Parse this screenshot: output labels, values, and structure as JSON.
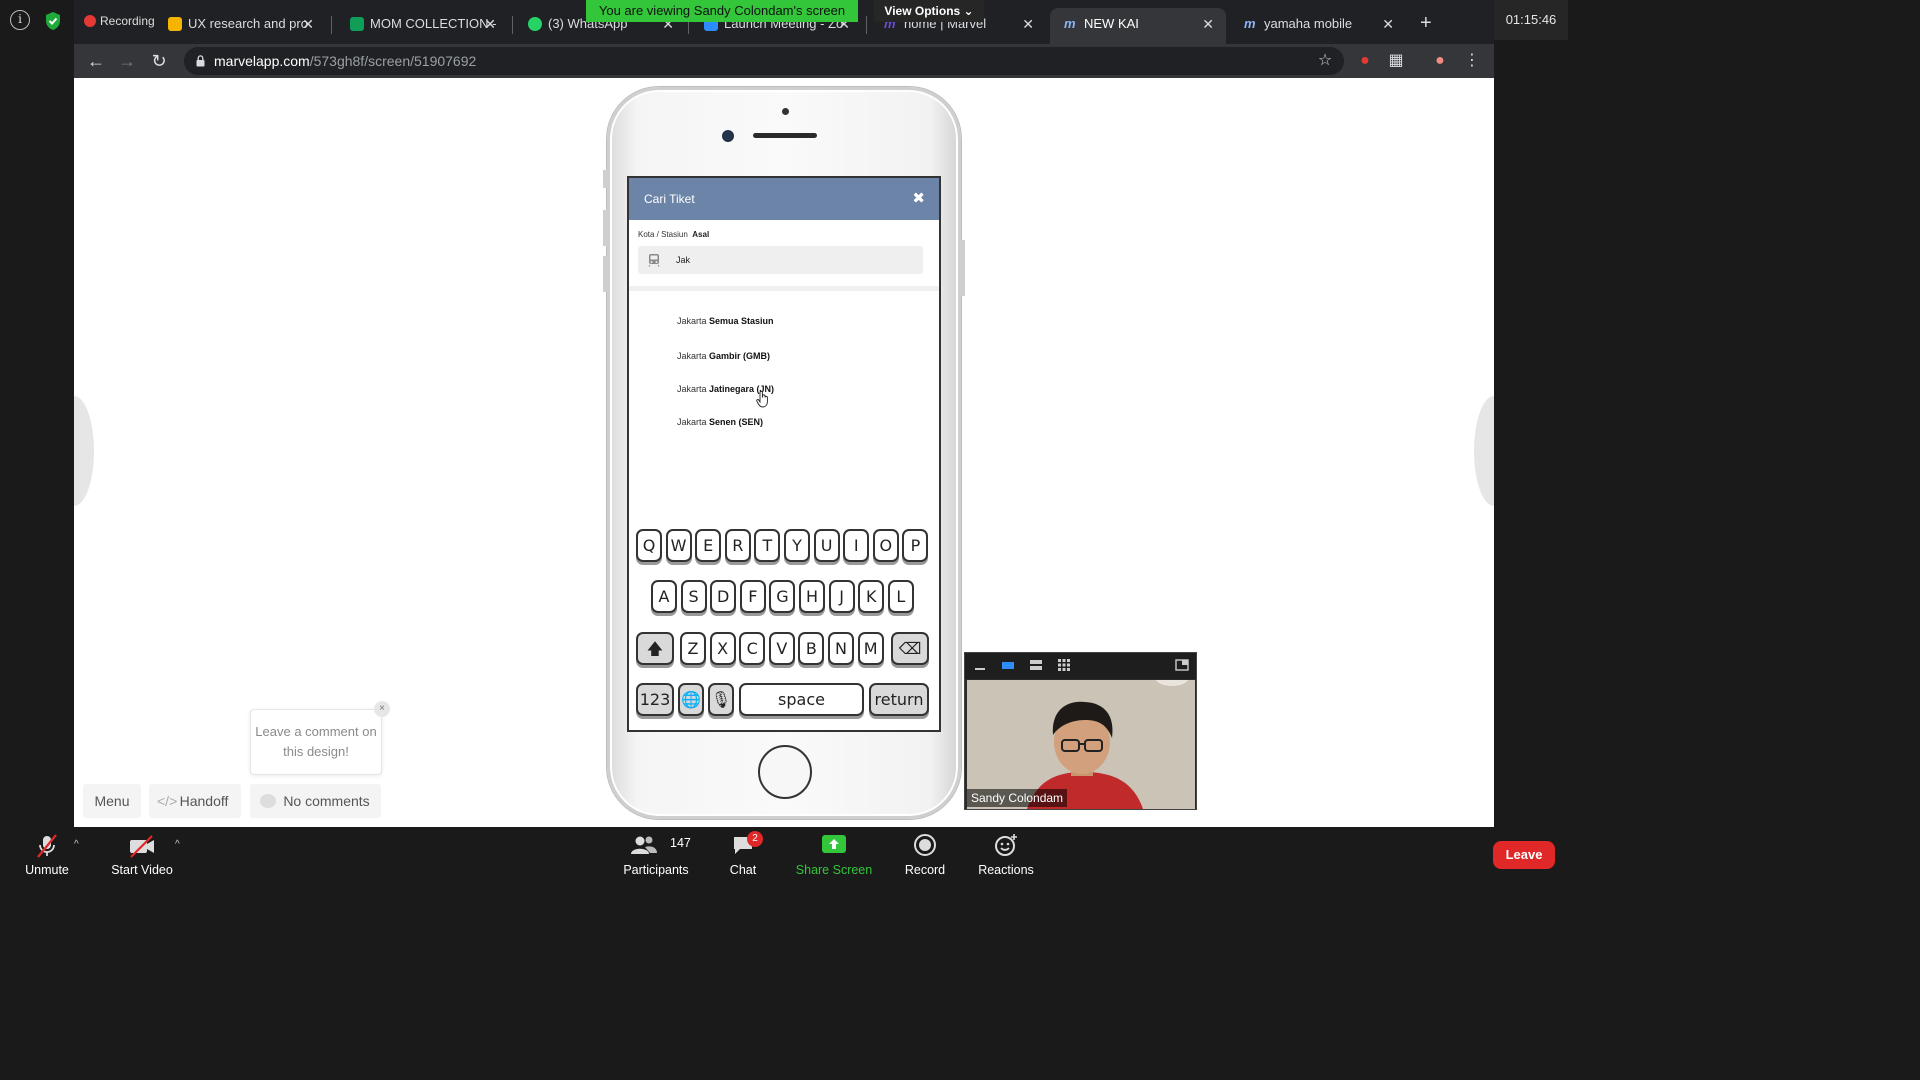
{
  "zoom": {
    "clock": "01:15:46",
    "recording_label": "Recording",
    "banner": "You are viewing Sandy Colondam's screen",
    "view_options": "View Options ⌄"
  },
  "browser": {
    "tabs": [
      {
        "title": "UX research and pro",
        "icon_color": "#f4b400"
      },
      {
        "title": "MOM COLLECTION -",
        "icon_color": "#0f9d58"
      },
      {
        "title": "(3) WhatsApp",
        "icon_color": "#25d366"
      },
      {
        "title": "Launch Meeting - Zo",
        "icon_color": "#2d8cff"
      },
      {
        "title": "home | Marvel",
        "icon_color": "#6c4bd6"
      },
      {
        "title": "NEW KAI",
        "icon_color": "#6c4bd6"
      },
      {
        "title": "yamaha mobile",
        "icon_color": "#6c4bd6"
      }
    ],
    "url_host": "marvelapp.com",
    "url_path": "/573gh8f/screen/51907692"
  },
  "prototype": {
    "header_title": "Cari Tiket",
    "close_glyph": "✖",
    "field_label_prefix": "Kota / Stasiun",
    "field_label_bold": "Asal",
    "input_value": "Jak",
    "suggestions": [
      {
        "prefix": "Jakarta",
        "bold": "Semua Stasiun"
      },
      {
        "prefix": "Jakarta",
        "bold": "Gambir (GMB)"
      },
      {
        "prefix": "Jakarta",
        "bold": "Jatinegara (JN)"
      },
      {
        "prefix": "Jakarta",
        "bold": "Senen (SEN)"
      }
    ],
    "keyboard": {
      "row1": [
        "Q",
        "W",
        "E",
        "R",
        "T",
        "Y",
        "U",
        "I",
        "O",
        "P"
      ],
      "row2": [
        "A",
        "S",
        "D",
        "F",
        "G",
        "H",
        "J",
        "K",
        "L"
      ],
      "row3": [
        "Z",
        "X",
        "C",
        "V",
        "B",
        "N",
        "M"
      ],
      "shift": "🡅",
      "backspace": "⌫",
      "numbers": "123",
      "globe": "🌐",
      "mic": "🎙",
      "space": "space",
      "return": "return"
    }
  },
  "marvel": {
    "menu": "Menu",
    "handoff": "Handoff",
    "comments": "No comments",
    "comment_tip": "Leave a comment on this design!",
    "tip_close": "×"
  },
  "video": {
    "participant_name": "Sandy Colondam"
  },
  "toolbar": {
    "unmute": "Unmute",
    "start_video": "Start Video",
    "participants": "Participants",
    "participant_count": "147",
    "chat": "Chat",
    "chat_badge": "2",
    "share_screen": "Share Screen",
    "record": "Record",
    "reactions": "Reactions",
    "leave": "Leave"
  },
  "colors": {
    "header_blue": "#6b84a8",
    "share_green": "#33c53a",
    "leave_red": "#e02828"
  }
}
